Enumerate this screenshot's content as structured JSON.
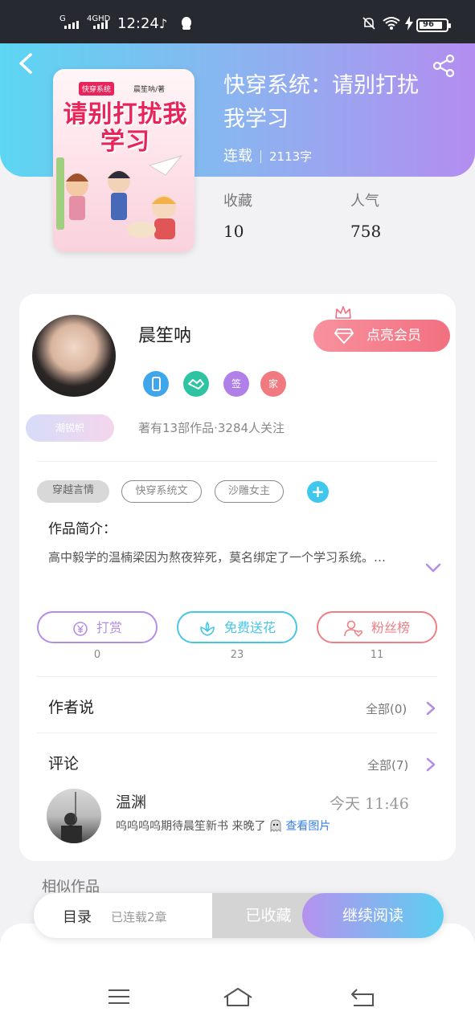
{
  "status_bar": {
    "signal1_label": "G",
    "signal2_label": "4GHD",
    "time": "12:24",
    "battery_level": "96",
    "icons": [
      "tiktok-icon",
      "qq-icon",
      "mute-icon",
      "wifi-icon",
      "charging-icon",
      "battery-icon"
    ]
  },
  "book": {
    "cover_tag": "快穿系统",
    "cover_author": "晨笙呐/著",
    "cover_title": "请别打扰我学习",
    "title": "快穿系统：请别打扰我学习",
    "status": "连载",
    "word_count": "2113字",
    "favorites_label": "收藏",
    "favorites_value": "10",
    "popularity_label": "人气",
    "popularity_value": "758"
  },
  "author": {
    "name": "晨笙呐",
    "badge_text": "潮锐帜",
    "vip_button": "点亮会员",
    "badges": [
      {
        "icon": "phone-badge-icon",
        "text": "",
        "color": "#3fa6ec"
      },
      {
        "icon": "handshake-badge-icon",
        "text": "",
        "color": "#2ec4a2"
      },
      {
        "icon": "sign-badge-icon",
        "text": "签",
        "color": "#b07fe8"
      },
      {
        "icon": "home-badge-icon",
        "text": "家",
        "color": "#f07a80"
      }
    ],
    "stats": "著有13部作品·3284人关注"
  },
  "tags": [
    "穿越言情",
    "快穿系统文",
    "沙雕女主"
  ],
  "intro": {
    "label": "作品简介：",
    "text": "高中毅学的温楠梁因为熬夜猝死，莫名绑定了一个学习系统。…"
  },
  "actions": [
    {
      "label": "打赏",
      "count": "0",
      "icon": "yen-icon",
      "color": "#b48ee6"
    },
    {
      "label": "免费送花",
      "count": "23",
      "icon": "flower-icon",
      "color": "#48c6e6"
    },
    {
      "label": "粉丝榜",
      "count": "11",
      "icon": "fans-icon",
      "color": "#ee7f84"
    }
  ],
  "author_says": {
    "label": "作者说",
    "all": "全部(0)"
  },
  "comments": {
    "label": "评论",
    "all": "全部(7)",
    "items": [
      {
        "user": "温渊",
        "time": "今天 11:46",
        "text": "呜呜呜呜期待晨笙新书 来晚了",
        "emoji": "ghost-emoji-icon",
        "link": "查看图片"
      }
    ]
  },
  "similar": {
    "label": "相似作品"
  },
  "bottom_bar": {
    "toc": "目录",
    "chapters": "已连载2章",
    "favorited": "已收藏",
    "continue": "继续阅读"
  },
  "colors": {
    "header_gradient": [
      "#5cd6f2",
      "#b38df0"
    ],
    "vip": "#f27080",
    "accent_blue": "#3fc8ec"
  }
}
